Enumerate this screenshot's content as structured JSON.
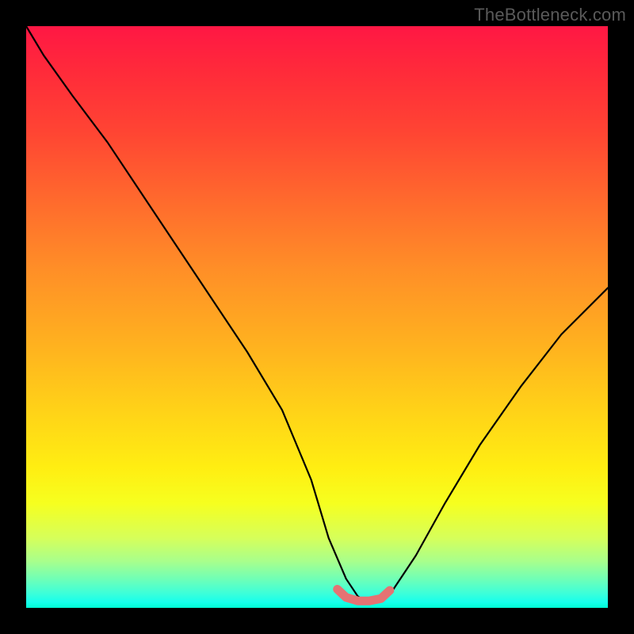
{
  "watermark": "TheBottleneck.com",
  "chart_data": {
    "type": "line",
    "title": "",
    "xlabel": "",
    "ylabel": "",
    "xlim": [
      0,
      100
    ],
    "ylim": [
      0,
      100
    ],
    "series": [
      {
        "name": "bottleneck-curve",
        "x": [
          0,
          3,
          8,
          14,
          20,
          26,
          32,
          38,
          44,
          49,
          52,
          55,
          57,
          58.5,
          60,
          63,
          67,
          72,
          78,
          85,
          92,
          100
        ],
        "values": [
          100,
          95,
          88,
          80,
          71,
          62,
          53,
          44,
          34,
          22,
          12,
          5,
          2,
          1,
          1,
          3,
          9,
          18,
          28,
          38,
          47,
          55
        ]
      },
      {
        "name": "optimal-highlight",
        "x": [
          53.5,
          55,
          57,
          59,
          61,
          62.5
        ],
        "values": [
          3.2,
          1.8,
          1.2,
          1.2,
          1.6,
          3.0
        ]
      }
    ],
    "annotations": []
  },
  "colors": {
    "curve": "#000000",
    "highlight": "#e57373"
  }
}
